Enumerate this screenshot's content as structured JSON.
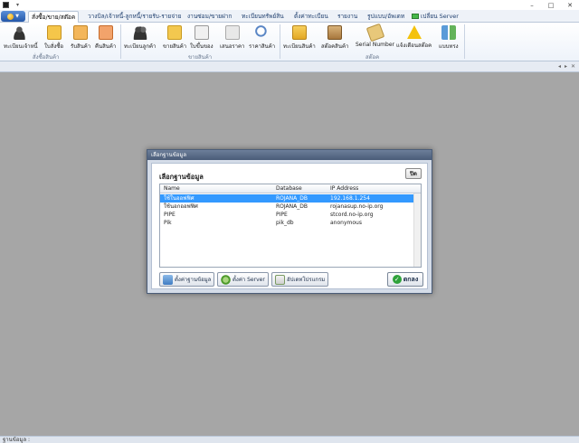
{
  "window": {
    "quick_access_arrow": "▾",
    "minimize": "–",
    "maximize": "□",
    "close": "✕"
  },
  "tabs": [
    {
      "label": "สั่งซื้อ/ขาย/สต๊อค",
      "active": true
    },
    {
      "label": "วางบิล/เจ้าหนี้-ลูกหนี้/รายรับ-รายจ่าย"
    },
    {
      "label": "งานซ่อม/ขายฝาก"
    },
    {
      "label": "ทะเบียนทรัพย์สิน"
    },
    {
      "label": "ตั้งค่าทะเบียน"
    },
    {
      "label": "รายงาน"
    },
    {
      "label": "รูปแบบ/อัพเดท"
    },
    {
      "label": "เปลี่ยน Server"
    }
  ],
  "ribbon": {
    "groups": [
      {
        "label": "สั่งซื้อสินค้า"
      },
      {
        "label": "ขายสินค้า"
      },
      {
        "label": "สต๊อค"
      }
    ],
    "buttons": [
      {
        "label": "ทะเบียนเจ้าหนี้",
        "icon": "users-icon"
      },
      {
        "label": "ใบสั่งซื้อ",
        "icon": "purchase-order-icon"
      },
      {
        "label": "รับสินค้า",
        "icon": "receive-goods-icon"
      },
      {
        "label": "คืนสินค้า",
        "icon": "return-goods-icon"
      },
      {
        "label": "ทะเบียนลูกค้า",
        "icon": "customers-icon"
      },
      {
        "label": "ขายสินค้า",
        "icon": "sell-icon"
      },
      {
        "label": "ใบขึ้นของ",
        "icon": "bill-icon"
      },
      {
        "label": "เสนอราคา",
        "icon": "quotation-icon"
      },
      {
        "label": "ราคาสินค้า",
        "icon": "price-search-icon"
      },
      {
        "label": "ทะเบียนสินค้า",
        "icon": "product-icon"
      },
      {
        "label": "สต๊อคสินค้า",
        "icon": "stock-icon"
      },
      {
        "label": "Serial Number",
        "icon": "serial-icon"
      },
      {
        "label": "แจ้งเตือนสต๊อค",
        "icon": "alert-icon"
      },
      {
        "label": "แบบทรง",
        "icon": "category-icon"
      }
    ]
  },
  "strip": {
    "icons": [
      "◂",
      "▸",
      "✕"
    ]
  },
  "status": {
    "text": "ฐานข้อมูล :"
  },
  "dialog": {
    "title": "เลือกฐานข้อมูล",
    "panel_title": "เลือกฐานข้อมูล",
    "close_label": "ปิด",
    "columns": [
      "Name",
      "Database",
      "IP Address"
    ],
    "rows": [
      {
        "name": "ใช้ในออฟฟิศ",
        "database": "ROJANA_DB",
        "ip": "192.168.1.254",
        "selected": true
      },
      {
        "name": "ใช้นอกออฟฟิศ",
        "database": "ROJANA_DB",
        "ip": "rojanasup.no-ip.org"
      },
      {
        "name": "PIPE",
        "database": "PIPE",
        "ip": "stcord.no-ip.org"
      },
      {
        "name": "Pik",
        "database": "pik_db",
        "ip": "anonymous"
      }
    ],
    "buttons": {
      "db_settings": "ตั้งค่าฐานข้อมูล",
      "server_settings": "ตั้งค่า Server",
      "update_program": "อัปเดทโปรแกรม",
      "ok": "ตกลง"
    }
  }
}
